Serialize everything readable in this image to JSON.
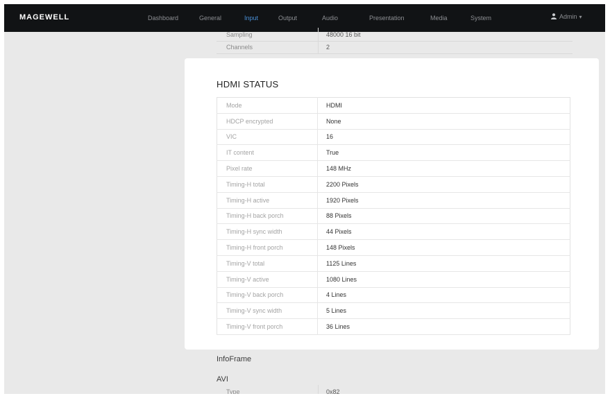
{
  "brand": {
    "logo_text": "MAGEWELL"
  },
  "nav": {
    "items": [
      {
        "label": "Dashboard",
        "active": false
      },
      {
        "label": "General",
        "active": false
      },
      {
        "label": "Input",
        "active": true
      },
      {
        "label": "Output",
        "active": false
      },
      {
        "label": "Audio",
        "active": false
      },
      {
        "label": "Presentation",
        "active": false
      },
      {
        "label": "Media",
        "active": false
      },
      {
        "label": "System",
        "active": false
      }
    ],
    "user_label": "Admin",
    "user_icon": "user-icon",
    "dropdown_icon": "chevron-down-icon"
  },
  "background": {
    "rows": [
      {
        "key": "Sampling",
        "value": "48000 16 bit"
      },
      {
        "key": "Channels",
        "value": "2"
      }
    ],
    "infoframe_heading": "InfoFrame",
    "avi_heading": "AVI",
    "avi_rows": [
      {
        "key": "Type",
        "value": "0x82"
      }
    ]
  },
  "modal": {
    "title": "HDMI STATUS",
    "rows": [
      {
        "key": "Mode",
        "value": "HDMI"
      },
      {
        "key": "HDCP encrypted",
        "value": "None"
      },
      {
        "key": "VIC",
        "value": "16"
      },
      {
        "key": "IT content",
        "value": "True"
      },
      {
        "key": "Pixel rate",
        "value": "148 MHz"
      },
      {
        "key": "Timing-H total",
        "value": "2200 Pixels"
      },
      {
        "key": "Timing-H active",
        "value": "1920 Pixels"
      },
      {
        "key": "Timing-H back porch",
        "value": "88 Pixels"
      },
      {
        "key": "Timing-H sync width",
        "value": "44 Pixels"
      },
      {
        "key": "Timing-H front porch",
        "value": "148 Pixels"
      },
      {
        "key": "Timing-V total",
        "value": "1125 Lines"
      },
      {
        "key": "Timing-V active",
        "value": "1080 Lines"
      },
      {
        "key": "Timing-V back porch",
        "value": "4 Lines"
      },
      {
        "key": "Timing-V sync width",
        "value": "5 Lines"
      },
      {
        "key": "Timing-V front porch",
        "value": "36 Lines"
      }
    ]
  }
}
